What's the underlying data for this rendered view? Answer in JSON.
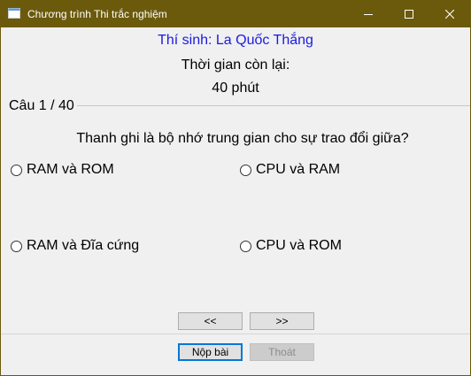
{
  "window": {
    "title": "Chương trình Thi trắc nghiệm",
    "titlebar_color": "#6b5a0c",
    "icon": "app-window-icon"
  },
  "header": {
    "candidate": "Thí sinh: La Quốc Thắng",
    "candidate_color": "#1b1be0",
    "time_label": "Thời gian còn lại:",
    "time_value": "40 phút"
  },
  "question": {
    "counter": "Câu 1 / 40",
    "text": "Thanh ghi là bộ nhớ trung gian cho sự trao đổi giữa?",
    "options": [
      {
        "label": "RAM và ROM",
        "selected": false
      },
      {
        "label": "CPU và RAM",
        "selected": false
      },
      {
        "label": "RAM và Đĩa cứng",
        "selected": false
      },
      {
        "label": "CPU và ROM",
        "selected": false
      }
    ]
  },
  "navigation": {
    "prev_label": "<<",
    "next_label": ">>"
  },
  "footer": {
    "submit_label": "Nộp bài",
    "exit_label": "Thoát",
    "exit_enabled": false
  }
}
